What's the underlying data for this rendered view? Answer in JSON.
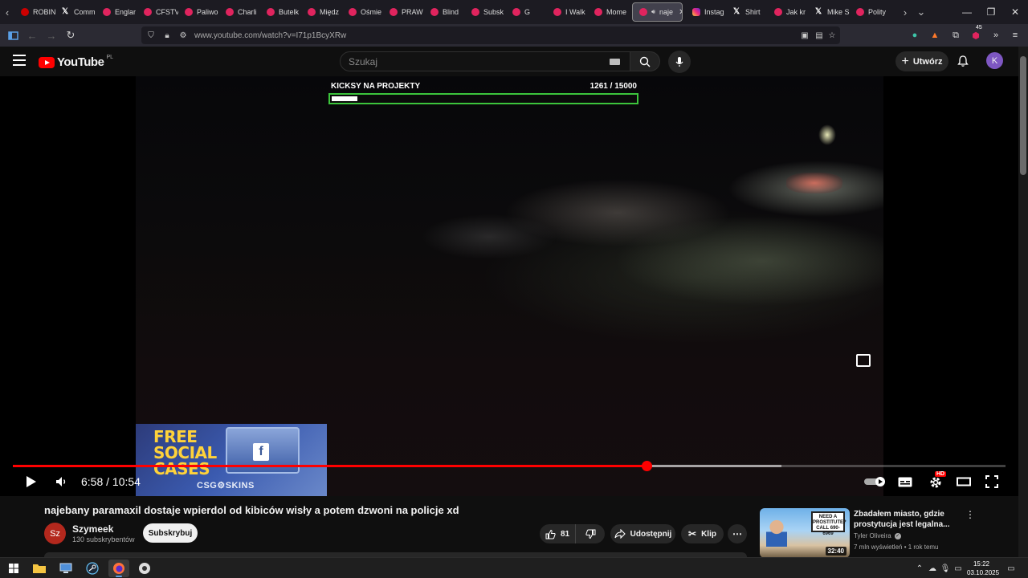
{
  "browser": {
    "tabs": [
      {
        "label": "ROBIN",
        "icon": "dot-icon"
      },
      {
        "label": "Comm",
        "icon": "x-icon"
      },
      {
        "label": "Englar",
        "icon": "youtube-icon"
      },
      {
        "label": "CFSTV",
        "icon": "youtube-icon"
      },
      {
        "label": "Paliwo",
        "icon": "youtube-icon"
      },
      {
        "label": "Charli",
        "icon": "youtube-icon"
      },
      {
        "label": "Butelk",
        "icon": "youtube-icon"
      },
      {
        "label": "Międz",
        "icon": "youtube-icon"
      },
      {
        "label": "Ośmie",
        "icon": "youtube-icon"
      },
      {
        "label": "PRAW",
        "icon": "youtube-icon"
      },
      {
        "label": "Blind",
        "icon": "youtube-icon"
      },
      {
        "label": "Subsk",
        "icon": "youtube-icon"
      },
      {
        "label": "G",
        "icon": "youtube-icon"
      },
      {
        "label": "I Walk",
        "icon": "youtube-icon"
      },
      {
        "label": "Mome",
        "icon": "youtube-icon"
      },
      {
        "label": "naje",
        "icon": "youtube-icon",
        "active": true
      },
      {
        "label": "Instag",
        "icon": "instagram-icon"
      },
      {
        "label": "Shirt",
        "icon": "x-icon"
      },
      {
        "label": "Jak kr",
        "icon": "youtube-icon"
      },
      {
        "label": "Mike S",
        "icon": "x-icon"
      },
      {
        "label": "Polity",
        "icon": "youtube-icon"
      }
    ],
    "url": "www.youtube.com/watch?v=I71p1BcyXRw",
    "extension_badge": "45"
  },
  "youtube": {
    "logo_text": "YouTube",
    "region": "PL",
    "search_placeholder": "Szukaj",
    "create_label": "Utwórz",
    "avatar_letter": "K"
  },
  "player": {
    "overlay_goal_title": "KICKSY NA PROJEKTY",
    "overlay_goal_count": "1261   / 15000",
    "goal_current": 1261,
    "goal_target": 15000,
    "ad": {
      "line1": "FREE",
      "line2": "SOCIAL",
      "line3": "CASES",
      "brand": "CSG⚙SKINS",
      "box_icon": "f"
    },
    "time_current": "6:58",
    "time_total": "10:54",
    "time_display": "6:58 / 10:54",
    "progress_fraction": 0.638,
    "buffered_fraction": 0.774,
    "quality_badge": "HD"
  },
  "video": {
    "title": "najebany paramaxil dostaje wpierdol od kibiców wisły a potem dzwoni na policje xd",
    "channel": {
      "avatar_initials": "Sz",
      "name": "Szymeek",
      "subscribers": "130 subskrybentów"
    },
    "subscribe_label": "Subskrybuj",
    "likes": "81",
    "share_label": "Udostępnij",
    "clip_label": "Klip"
  },
  "recommendation": {
    "title": "Zbadałem miasto, gdzie prostytucja jest legalna...",
    "channel": "Tyler Oliveira",
    "meta": "7 mln wyświetleń • 1 rok temu",
    "duration": "32:40",
    "thumb_sign": "NEED A PROSTITUTE? CALL 690-6969"
  },
  "taskbar": {
    "time": "15:22",
    "date": "03.10.2025"
  },
  "colors": {
    "yt_red": "#ff0000",
    "progress_red": "#f00",
    "goal_green": "#3cc43c",
    "background": "#0f0f0f"
  }
}
